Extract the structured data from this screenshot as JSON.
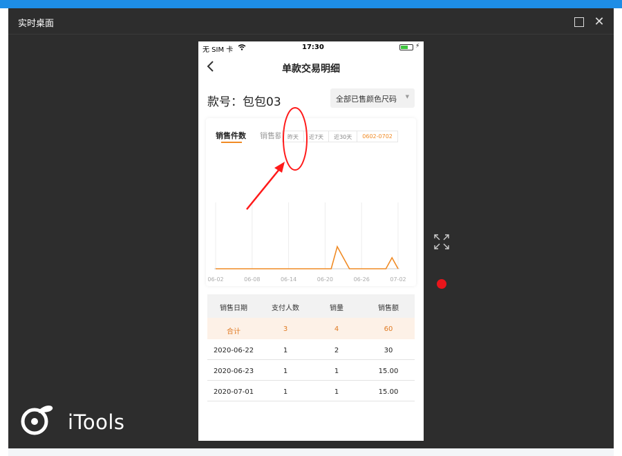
{
  "window": {
    "title": "实时桌面"
  },
  "logo": {
    "text": "iTools"
  },
  "phone": {
    "status": {
      "carrier": "无 SIM 卡",
      "time": "17:30"
    },
    "nav": {
      "title": "单款交易明细"
    },
    "sku": {
      "label": "款号：",
      "value": "包包03"
    },
    "filter": {
      "label": "全部已售颜色尺码"
    },
    "chart": {
      "tabs": [
        {
          "label": "销售件数",
          "active": true
        },
        {
          "label": "销售额",
          "active": false
        }
      ],
      "ranges": [
        "昨天",
        "近7天",
        "近30天",
        "0602-0702"
      ],
      "active_range": "0602-0702",
      "accent_color": "#f08a24"
    },
    "table": {
      "headers": [
        "销售日期",
        "支付人数",
        "销量",
        "销售额"
      ],
      "total": [
        "合计",
        "3",
        "4",
        "60"
      ],
      "rows": [
        [
          "2020-06-22",
          "1",
          "2",
          "30"
        ],
        [
          "2020-06-23",
          "1",
          "1",
          "15.00"
        ],
        [
          "2020-07-01",
          "1",
          "1",
          "15.00"
        ]
      ]
    }
  },
  "chart_data": {
    "type": "line",
    "x": [
      "06-02",
      "06-08",
      "06-14",
      "06-20",
      "06-26",
      "07-02"
    ],
    "x_tick_labels": [
      "06-02",
      "06-08",
      "06-14",
      "06-20",
      "06-26",
      "07-02"
    ],
    "series": [
      {
        "dates": [
          "06-02",
          "06-20",
          "06-21",
          "06-22",
          "06-23",
          "06-24",
          "06-25",
          "06-26",
          "06-27",
          "06-28",
          "06-29",
          "06-30",
          "07-01",
          "07-02"
        ],
        "values": [
          0,
          0,
          0,
          2,
          1,
          0,
          0,
          0,
          0,
          0,
          0,
          0,
          1,
          0
        ],
        "color": "#f08a24"
      }
    ],
    "grid": "vertical",
    "legend": "none"
  },
  "colors": {
    "annotation": "#ff1a1a",
    "record_dot": "#e8151b"
  }
}
